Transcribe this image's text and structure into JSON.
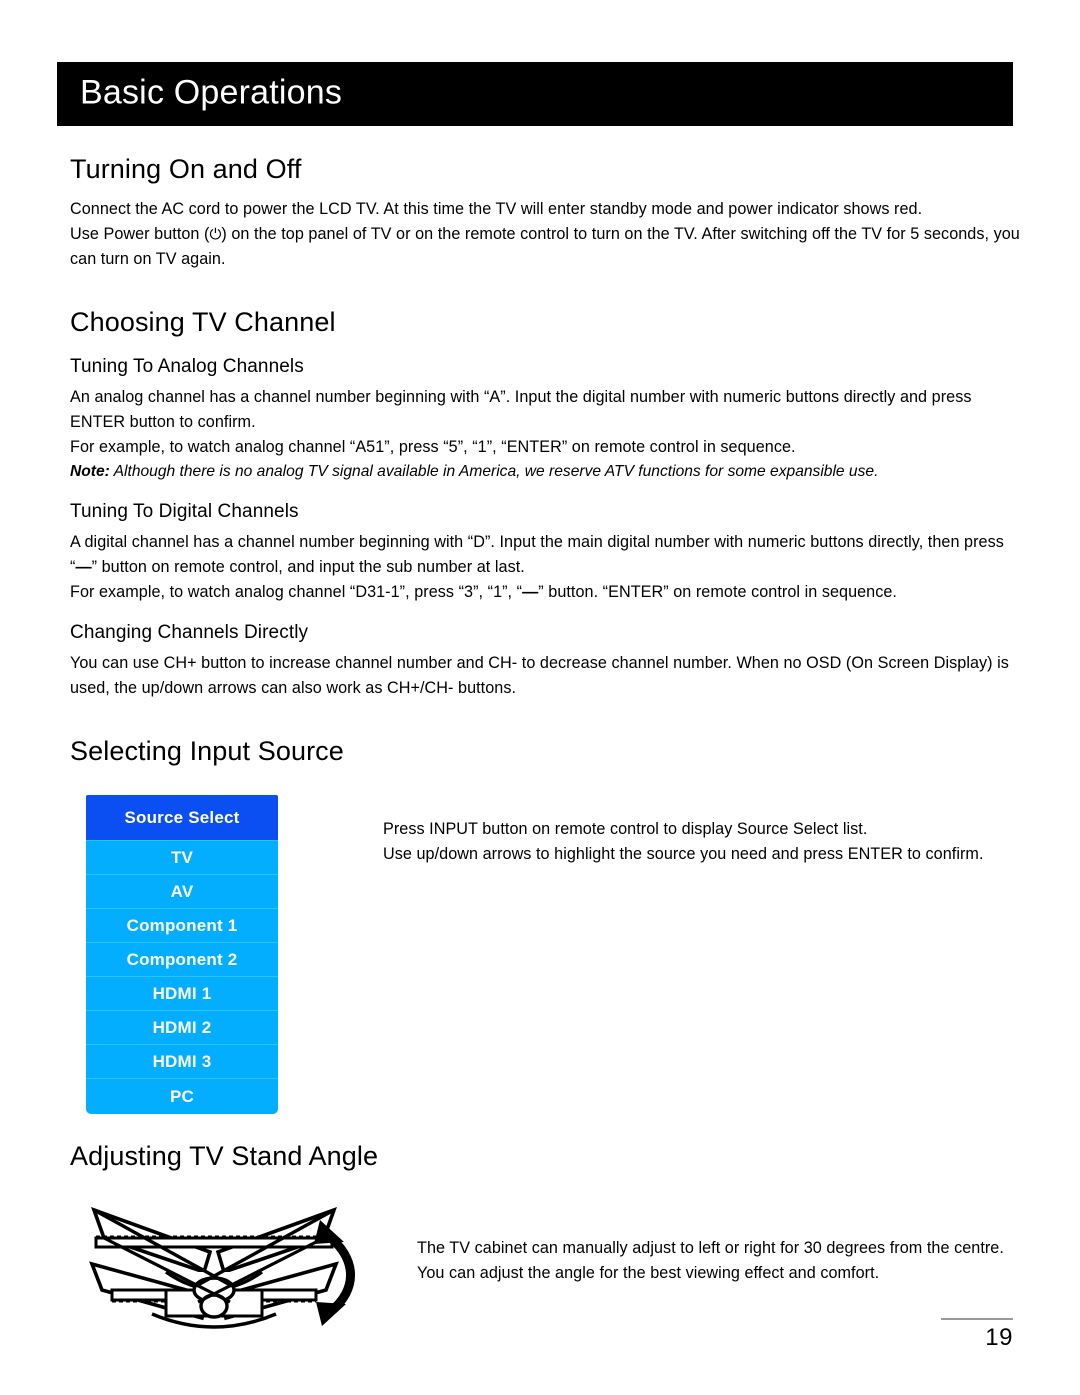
{
  "page": {
    "banner_title": "Basic Operations",
    "page_number": "19"
  },
  "sections": {
    "turning_on_off": {
      "heading": "Turning On and Off",
      "paragraph_1": "Connect the AC cord to power the LCD TV. At this time the TV will enter standby mode and power indicator shows red.",
      "paragraph_2_before": "Use Power button (",
      "power_icon_glyph": "⏻",
      "paragraph_2_after": ") on the top panel of TV or on the remote control to turn on the TV. After switching off the TV for 5 seconds, you can turn on TV again."
    },
    "choosing_tv_channel": {
      "heading": "Choosing TV Channel",
      "analog": {
        "subheading": "Tuning To Analog Channels",
        "paragraph_1": "An analog channel has a channel number beginning with “A”. Input the digital number with numeric buttons directly and press ENTER button to confirm.",
        "paragraph_2": "For example, to watch analog channel “A51”, press “5”, “1”, “ENTER” on remote control in sequence.",
        "note_label": "Note:",
        "note_text": "Although there is no analog TV signal available in America, we reserve ATV functions for some expansible use."
      },
      "digital": {
        "subheading": "Tuning To Digital Channels",
        "paragraph_1_before": "A digital channel has a channel number beginning with “D”. Input the main digital number with numeric buttons directly, then press “",
        "dash_glyph": "—",
        "paragraph_1_after": "” button on remote control, and input the sub number at last.",
        "paragraph_2_before": "For example, to watch analog channel “D31-1”, press “3”, “1”, “",
        "paragraph_2_after": "” button. “ENTER” on remote control in sequence."
      },
      "changing": {
        "subheading": "Changing Channels Directly",
        "paragraph_1": "You can use CH+ button to increase channel number and CH- to decrease channel number. When no OSD (On Screen Display) is used, the up/down arrows can also work as CH+/CH- buttons."
      }
    },
    "selecting_input_source": {
      "heading": "Selecting Input Source",
      "menu": {
        "header_label": "Source Select",
        "header_color": "#0b4ef2",
        "item_color": "#03adff",
        "items": [
          {
            "label": "TV"
          },
          {
            "label": "AV"
          },
          {
            "label": "Component 1"
          },
          {
            "label": "Component 2"
          },
          {
            "label": "HDMI 1"
          },
          {
            "label": "HDMI 2"
          },
          {
            "label": "HDMI 3"
          },
          {
            "label": "PC"
          }
        ]
      },
      "paragraph_1": "Press INPUT button on remote control to display Source Select list.",
      "paragraph_2": "Use up/down arrows to highlight the source you need and press ENTER to confirm."
    },
    "adjusting_stand_angle": {
      "heading": "Adjusting TV Stand Angle",
      "paragraph_1": "The TV cabinet can manually adjust to left or right for 30 degrees from the centre.",
      "paragraph_2": "You can adjust the angle for the best viewing effect and comfort."
    }
  }
}
